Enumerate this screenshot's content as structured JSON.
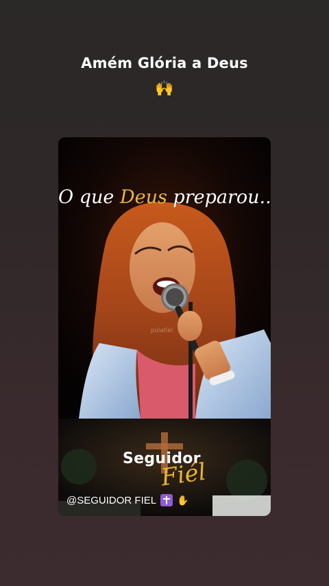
{
  "caption": {
    "text": "Amém Glória a Deus",
    "emoji": "🙌"
  },
  "card": {
    "phrase_part1": "O que ",
    "phrase_highlight": "Deus",
    "phrase_part2": " preparou...",
    "watermark": "pulafiel",
    "brand_name": "Seguidor",
    "brand_script": "Fiél",
    "handle": "@SEGUIDOR FIEL",
    "icons": [
      "latin-cross-icon",
      "praying-hands-icon"
    ]
  },
  "colors": {
    "accent_gold": "#e7b93a",
    "cross_badge": "#8f5bd6"
  }
}
